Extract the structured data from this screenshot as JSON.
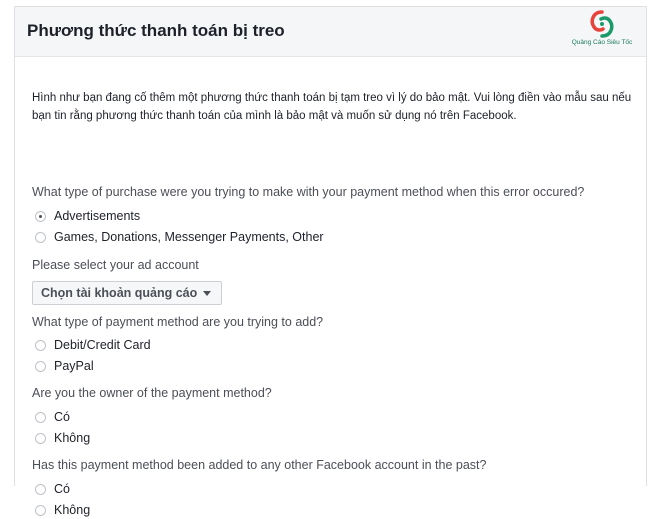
{
  "header": {
    "title": "Phương thức thanh toán bị treo",
    "logo_text": "Quảng Cáo Siêu Tốc",
    "logo_tagline": ""
  },
  "intro": "Hình như bạn đang cố thêm một phương thức thanh toán bị tạm treo vì lý do bảo mật. Vui lòng điền vào mẫu sau nếu bạn tin rằng phương thức thanh toán của mình là bảo mật và muốn sử dụng nó trên Facebook.",
  "q1": {
    "text": "What type of purchase were you trying to make with your payment method when this error occured?",
    "options": [
      "Advertisements",
      "Games, Donations, Messenger Payments, Other"
    ],
    "selected": 0
  },
  "ad_account": {
    "label": "Please select your ad account",
    "select_value": "Chọn tài khoản quảng cáo"
  },
  "q2": {
    "text": "What type of payment method are you trying to add?",
    "options": [
      "Debit/Credit Card",
      "PayPal"
    ]
  },
  "q3": {
    "text": "Are you the owner of the payment method?",
    "options": [
      "Có",
      "Không"
    ]
  },
  "q4": {
    "text": "Has this payment method been added to any other Facebook account in the past?",
    "options": [
      "Có",
      "Không"
    ]
  },
  "colors": {
    "header_bg": "#f5f6f7",
    "border": "#dddfe2",
    "logo_red": "#e8433a",
    "logo_green": "#1c9a6a"
  }
}
